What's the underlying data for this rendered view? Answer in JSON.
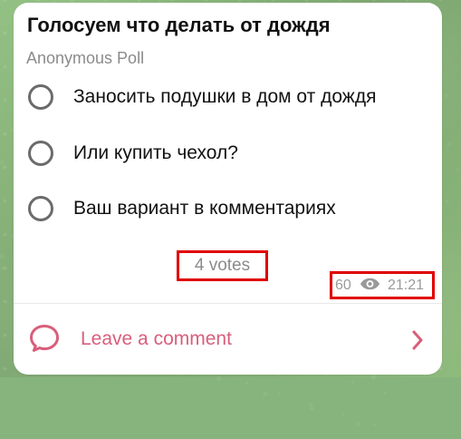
{
  "post": {
    "title": "Голосуем что делать от дождя",
    "poll_type": "Anonymous Poll",
    "options": [
      {
        "label": "Заносить подушки в дом от дождя"
      },
      {
        "label": "Или купить чехол?"
      },
      {
        "label": "Ваш вариант в комментариях"
      }
    ],
    "votes_text": "4 votes",
    "views_count": "60",
    "time": "21:21"
  },
  "comments": {
    "label": "Leave a comment"
  },
  "icons": {
    "view_icon": "eye-icon",
    "comment_icon": "comment-icon",
    "chevron_icon": "chevron-right-icon"
  },
  "colors": {
    "background": "#86b47c",
    "card": "#ffffff",
    "title_text": "#111111",
    "muted_text": "#8b8b8b",
    "radio_outline": "#6b6b6b",
    "comment_accent": "#d95e7b",
    "highlight_box": "#e00000"
  }
}
